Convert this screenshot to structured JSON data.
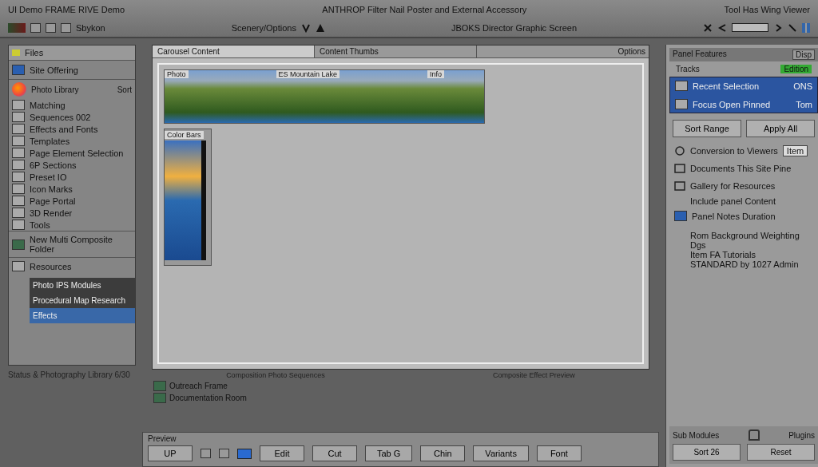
{
  "titlebar": {
    "left": "UI Demo FRAME RIVE Demo",
    "center": "ANTHROP Filter Nail Poster and External Accessory",
    "right": "Tool Has Wing Viewer"
  },
  "toolbar": {
    "label": "Sbykon",
    "center_label": "Scenery/Options",
    "right_label": "JBOKS Director Graphic Screen"
  },
  "sidebar": {
    "header": "Files",
    "top_item": "Site Offering",
    "group": {
      "title": "Photo Library",
      "action": "Sort"
    },
    "items": [
      "Matching",
      "Sequences 002",
      "Effects and Fonts",
      "Templates",
      "Page Element Selection",
      "6P Sections",
      "Preset IO",
      "Icon Marks",
      "Page Portal",
      "3D Render",
      "Tools"
    ],
    "folder": "New Multi Composite Folder",
    "resources": "Resources",
    "modules": [
      {
        "label": "Photo IPS Modules",
        "selected": false
      },
      {
        "label": "Procedural Map Research",
        "selected": false
      },
      {
        "label": "Effects",
        "selected": true
      }
    ]
  },
  "status": "Status & Photography Library 6/30",
  "editor": {
    "tabs": [
      {
        "label": "Carousel Content",
        "selected": true
      },
      {
        "label": "Content Thumbs",
        "selected": false
      }
    ],
    "options": "Options",
    "panorama": {
      "labels": [
        "Photo",
        "ES Mountain Lake",
        "Info"
      ]
    },
    "portrait": {
      "label": "Color Bars"
    }
  },
  "captions": [
    "Composition Photo Sequences",
    "Composite Effect Preview"
  ],
  "layers": [
    "Outreach Frame",
    "Documentation Room"
  ],
  "bottom_bar": {
    "title": "Preview",
    "buttons": [
      "UP",
      "Edit",
      "Cut",
      "Tab G",
      "Chin",
      "Variants",
      "Font"
    ]
  },
  "right_panel": {
    "header": "Panel Features",
    "dropdown": "Disp",
    "section": "Tracks",
    "badge": "Edition",
    "list": [
      {
        "label": "Recent Selection",
        "value": "ONS"
      },
      {
        "label": "Focus Open Pinned",
        "value": "Tom"
      }
    ],
    "buttons": [
      "Sort Range",
      "Apply All"
    ],
    "field": {
      "label": "Conversion to Viewers",
      "value": "Item"
    },
    "options": [
      "Documents This Site Pine",
      "Gallery for Resources"
    ],
    "note": "Include panel Content",
    "note2": "Panel Notes Duration",
    "details": [
      "Rom Background Weighting",
      "Dgs",
      "Item FA Tutorials",
      "STANDARD by 1027 Admin"
    ],
    "footer": {
      "labels": [
        "Sub Modules",
        "Plugins"
      ],
      "buttons": [
        "Sort 26",
        "Reset"
      ]
    }
  }
}
